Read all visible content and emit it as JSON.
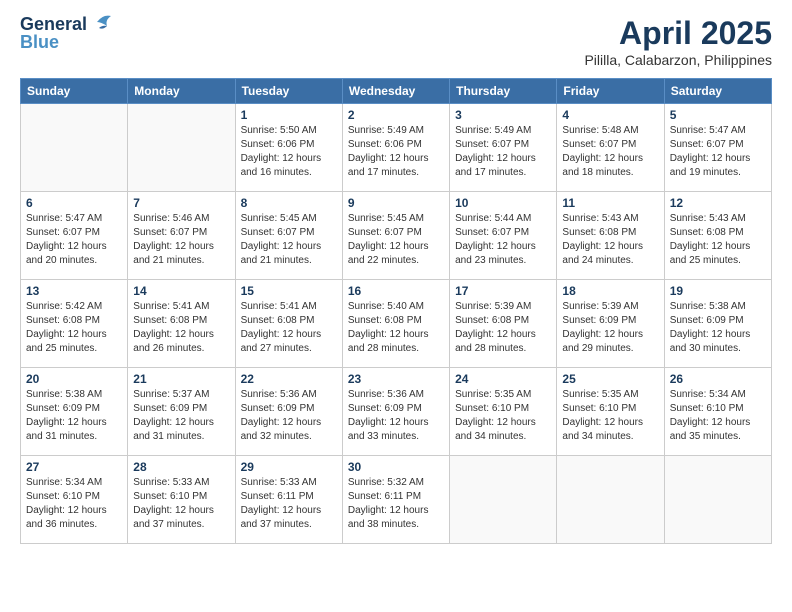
{
  "header": {
    "logo_line1": "General",
    "logo_line2": "Blue",
    "month_title": "April 2025",
    "location": "Pililla, Calabarzon, Philippines"
  },
  "weekdays": [
    "Sunday",
    "Monday",
    "Tuesday",
    "Wednesday",
    "Thursday",
    "Friday",
    "Saturday"
  ],
  "weeks": [
    [
      {
        "day": "",
        "info": ""
      },
      {
        "day": "",
        "info": ""
      },
      {
        "day": "1",
        "info": "Sunrise: 5:50 AM\nSunset: 6:06 PM\nDaylight: 12 hours\nand 16 minutes."
      },
      {
        "day": "2",
        "info": "Sunrise: 5:49 AM\nSunset: 6:06 PM\nDaylight: 12 hours\nand 17 minutes."
      },
      {
        "day": "3",
        "info": "Sunrise: 5:49 AM\nSunset: 6:07 PM\nDaylight: 12 hours\nand 17 minutes."
      },
      {
        "day": "4",
        "info": "Sunrise: 5:48 AM\nSunset: 6:07 PM\nDaylight: 12 hours\nand 18 minutes."
      },
      {
        "day": "5",
        "info": "Sunrise: 5:47 AM\nSunset: 6:07 PM\nDaylight: 12 hours\nand 19 minutes."
      }
    ],
    [
      {
        "day": "6",
        "info": "Sunrise: 5:47 AM\nSunset: 6:07 PM\nDaylight: 12 hours\nand 20 minutes."
      },
      {
        "day": "7",
        "info": "Sunrise: 5:46 AM\nSunset: 6:07 PM\nDaylight: 12 hours\nand 21 minutes."
      },
      {
        "day": "8",
        "info": "Sunrise: 5:45 AM\nSunset: 6:07 PM\nDaylight: 12 hours\nand 21 minutes."
      },
      {
        "day": "9",
        "info": "Sunrise: 5:45 AM\nSunset: 6:07 PM\nDaylight: 12 hours\nand 22 minutes."
      },
      {
        "day": "10",
        "info": "Sunrise: 5:44 AM\nSunset: 6:07 PM\nDaylight: 12 hours\nand 23 minutes."
      },
      {
        "day": "11",
        "info": "Sunrise: 5:43 AM\nSunset: 6:08 PM\nDaylight: 12 hours\nand 24 minutes."
      },
      {
        "day": "12",
        "info": "Sunrise: 5:43 AM\nSunset: 6:08 PM\nDaylight: 12 hours\nand 25 minutes."
      }
    ],
    [
      {
        "day": "13",
        "info": "Sunrise: 5:42 AM\nSunset: 6:08 PM\nDaylight: 12 hours\nand 25 minutes."
      },
      {
        "day": "14",
        "info": "Sunrise: 5:41 AM\nSunset: 6:08 PM\nDaylight: 12 hours\nand 26 minutes."
      },
      {
        "day": "15",
        "info": "Sunrise: 5:41 AM\nSunset: 6:08 PM\nDaylight: 12 hours\nand 27 minutes."
      },
      {
        "day": "16",
        "info": "Sunrise: 5:40 AM\nSunset: 6:08 PM\nDaylight: 12 hours\nand 28 minutes."
      },
      {
        "day": "17",
        "info": "Sunrise: 5:39 AM\nSunset: 6:08 PM\nDaylight: 12 hours\nand 28 minutes."
      },
      {
        "day": "18",
        "info": "Sunrise: 5:39 AM\nSunset: 6:09 PM\nDaylight: 12 hours\nand 29 minutes."
      },
      {
        "day": "19",
        "info": "Sunrise: 5:38 AM\nSunset: 6:09 PM\nDaylight: 12 hours\nand 30 minutes."
      }
    ],
    [
      {
        "day": "20",
        "info": "Sunrise: 5:38 AM\nSunset: 6:09 PM\nDaylight: 12 hours\nand 31 minutes."
      },
      {
        "day": "21",
        "info": "Sunrise: 5:37 AM\nSunset: 6:09 PM\nDaylight: 12 hours\nand 31 minutes."
      },
      {
        "day": "22",
        "info": "Sunrise: 5:36 AM\nSunset: 6:09 PM\nDaylight: 12 hours\nand 32 minutes."
      },
      {
        "day": "23",
        "info": "Sunrise: 5:36 AM\nSunset: 6:09 PM\nDaylight: 12 hours\nand 33 minutes."
      },
      {
        "day": "24",
        "info": "Sunrise: 5:35 AM\nSunset: 6:10 PM\nDaylight: 12 hours\nand 34 minutes."
      },
      {
        "day": "25",
        "info": "Sunrise: 5:35 AM\nSunset: 6:10 PM\nDaylight: 12 hours\nand 34 minutes."
      },
      {
        "day": "26",
        "info": "Sunrise: 5:34 AM\nSunset: 6:10 PM\nDaylight: 12 hours\nand 35 minutes."
      }
    ],
    [
      {
        "day": "27",
        "info": "Sunrise: 5:34 AM\nSunset: 6:10 PM\nDaylight: 12 hours\nand 36 minutes."
      },
      {
        "day": "28",
        "info": "Sunrise: 5:33 AM\nSunset: 6:10 PM\nDaylight: 12 hours\nand 37 minutes."
      },
      {
        "day": "29",
        "info": "Sunrise: 5:33 AM\nSunset: 6:11 PM\nDaylight: 12 hours\nand 37 minutes."
      },
      {
        "day": "30",
        "info": "Sunrise: 5:32 AM\nSunset: 6:11 PM\nDaylight: 12 hours\nand 38 minutes."
      },
      {
        "day": "",
        "info": ""
      },
      {
        "day": "",
        "info": ""
      },
      {
        "day": "",
        "info": ""
      }
    ]
  ]
}
